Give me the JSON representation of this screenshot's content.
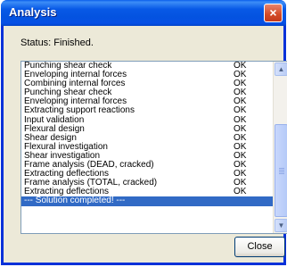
{
  "window": {
    "title": "Analysis",
    "close_glyph": "×"
  },
  "status": {
    "text": "Status:  Finished."
  },
  "list": {
    "rows": [
      {
        "task": "Punching shear check",
        "result": "OK"
      },
      {
        "task": "Enveloping internal forces",
        "result": "OK"
      },
      {
        "task": "Combining internal forces",
        "result": "OK"
      },
      {
        "task": "Punching shear check",
        "result": "OK"
      },
      {
        "task": "Enveloping internal forces",
        "result": "OK"
      },
      {
        "task": "Extracting support reactions",
        "result": "OK"
      },
      {
        "task": "Input validation",
        "result": "OK"
      },
      {
        "task": "Flexural design",
        "result": "OK"
      },
      {
        "task": "Shear design",
        "result": "OK"
      },
      {
        "task": "Flexural investigation",
        "result": "OK"
      },
      {
        "task": "Shear investigation",
        "result": "OK"
      },
      {
        "task": "Frame analysis (DEAD, cracked)",
        "result": "OK"
      },
      {
        "task": "Extracting deflections",
        "result": "OK"
      },
      {
        "task": "Frame analysis (TOTAL, cracked)",
        "result": "OK"
      },
      {
        "task": "Extracting deflections",
        "result": "OK"
      }
    ],
    "selected_row": "--- Solution completed! ---"
  },
  "buttons": {
    "close_label": "Close"
  },
  "colors": {
    "titlebar": "#0A5FEB",
    "selection": "#316AC5",
    "window_bg": "#ECE9D8"
  }
}
